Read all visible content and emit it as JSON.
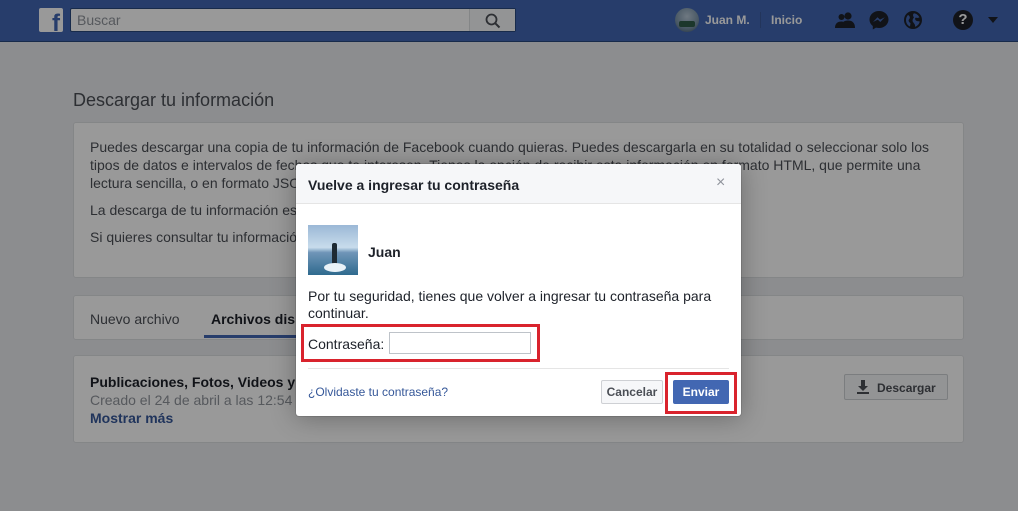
{
  "topbar": {
    "logo_letter": "f",
    "search_placeholder": "Buscar",
    "user_name": "Juan M.",
    "home_label": "Inicio",
    "icons": [
      "friends-icon",
      "messenger-icon",
      "globe-notifications-icon",
      "help-icon",
      "caret-down-icon"
    ]
  },
  "page": {
    "title": "Descargar tu información",
    "intro_paragraphs": [
      "Puedes descargar una copia de tu información de Facebook cuando quieras. Puedes descargarla en su totalidad o seleccionar solo los tipos de datos e intervalos de fechas que te interesen. Tienes la opción de recibir esta información en formato HTML, que permite una lectura sencilla, o en formato JSON",
      "La descarga de tu información es vez creado un archivo, estará disponible para su descarga dura",
      "Si quieres consultar tu informació"
    ],
    "tabs": [
      {
        "label": "Nuevo archivo"
      },
      {
        "label": "Archivos dis"
      }
    ],
    "file": {
      "title": "Publicaciones, Fotos, Videos y",
      "date": "Creado el 24 de abril a las 12:54",
      "more_link": "Mostrar más",
      "download_label": "Descargar"
    }
  },
  "dialog": {
    "title": "Vuelve a ingresar tu contraseña",
    "close_glyph": "×",
    "username": "Juan",
    "message": "Por tu seguridad, tienes que volver a ingresar tu contraseña para continuar.",
    "password_label": "Contraseña:",
    "password_value": "",
    "forgot_link": "¿Olvidaste tu contraseña?",
    "cancel_label": "Cancelar",
    "send_label": "Enviar"
  },
  "colors": {
    "brand": "#4267b2",
    "highlight": "#d9232d",
    "link": "#365899"
  }
}
